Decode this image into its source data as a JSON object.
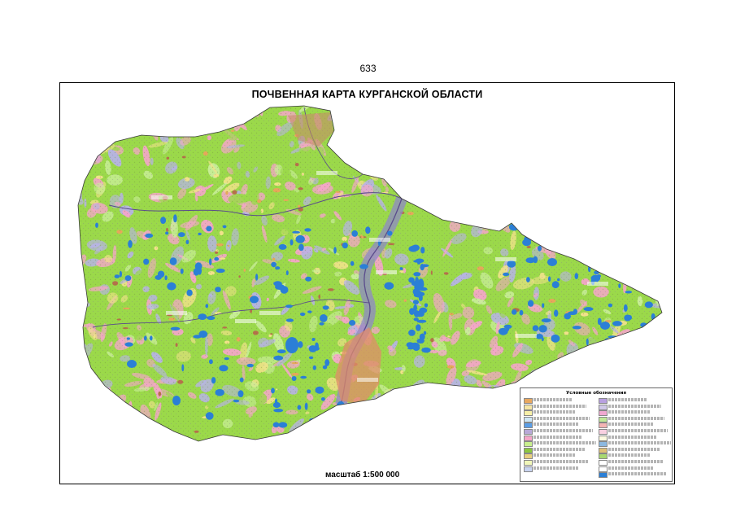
{
  "page": {
    "number": "633"
  },
  "map": {
    "title": "ПОЧВЕННАЯ КАРТА КУРГАНСКОЙ ОБЛАСТИ",
    "scale_text": "масштаб 1:500 000",
    "colors": {
      "green": "#9bd94a",
      "pink": "#f4a6c8",
      "lavender": "#b7b3e6",
      "blue_lake": "#2b7fd6",
      "yellow": "#f1e28a",
      "orange": "#e6a85a",
      "brown": "#b5704a",
      "river": "#5a4b8c",
      "light_green": "#c9ee9a"
    }
  },
  "legend": {
    "title": "Условные обозначения",
    "left_colors": [
      "#e8a860",
      "#f5e6a6",
      "#f7f0a8",
      "#cfe8f6",
      "#5a9ee6",
      "#b8a9d8",
      "#f4a6c8",
      "#c8ef8e",
      "#8cc840",
      "#e8d080",
      "#f0f6b8",
      "#c8d4f0"
    ],
    "right_colors": [
      "#b8a0e0",
      "#d0c8e8",
      "#f0a8d0",
      "#c0e898",
      "#f4b4b4",
      "#f8d0e0",
      "#fdfae0",
      "#8cb8e0",
      "#e0c078",
      "#a8d870",
      "#ffffff",
      "#ffffff",
      "#2b7fd6"
    ]
  }
}
